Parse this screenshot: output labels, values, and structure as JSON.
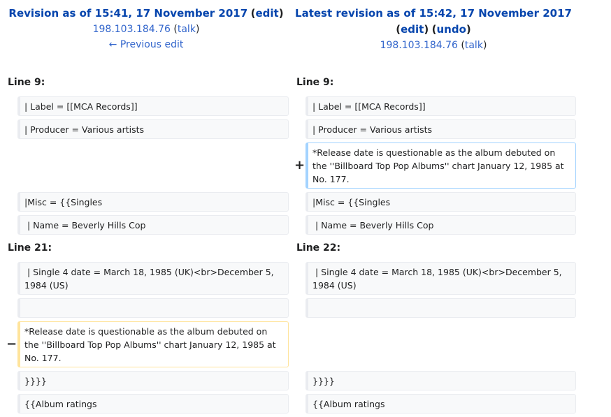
{
  "left_header": {
    "title": "Revision as of 15:41, 17 November 2017",
    "edit_label": "edit",
    "user": "198.103.184.76",
    "talk_label": "talk",
    "prev_edit": "← Previous edit"
  },
  "right_header": {
    "title": "Latest revision as of 15:42, 17 November 2017",
    "edit_label": "edit",
    "undo_label": "undo",
    "user": "198.103.184.76",
    "talk_label": "talk"
  },
  "sections": [
    {
      "left_line": "Line 9:",
      "right_line": "Line 9:"
    },
    {
      "left_line": "Line 21:",
      "right_line": "Line 22:"
    }
  ],
  "rows": [
    {
      "left": "| Label = [[MCA Records]]",
      "right": "| Label = [[MCA Records]]"
    },
    {
      "left": "| Producer = Various artists",
      "right": "| Producer = Various artists"
    },
    {
      "right_added": "*Release date is questionable as the album debuted on the ''Billboard Top Pop Albums'' chart January 12, 1985 at No. 177."
    },
    {
      "left": "|Misc = {{Singles",
      "right": "|Misc = {{Singles"
    },
    {
      "left": " | Name = Beverly Hills Cop",
      "right": " | Name = Beverly Hills Cop"
    },
    {
      "left": " | Single 4 date = March 18, 1985 (UK)<br>December 5, 1984 (US)",
      "right": " | Single 4 date = March 18, 1985 (UK)<br>December 5, 1984 (US)"
    },
    {
      "left": "",
      "right": ""
    },
    {
      "left_deleted": "*Release date is questionable as the album debuted on the ''Billboard Top Pop Albums'' chart January 12, 1985 at No. 177."
    },
    {
      "left": "}}}}",
      "right": "}}}}"
    },
    {
      "left": "{{Album ratings",
      "right": "{{Album ratings"
    }
  ],
  "markers": {
    "added": "+",
    "deleted": "−"
  }
}
